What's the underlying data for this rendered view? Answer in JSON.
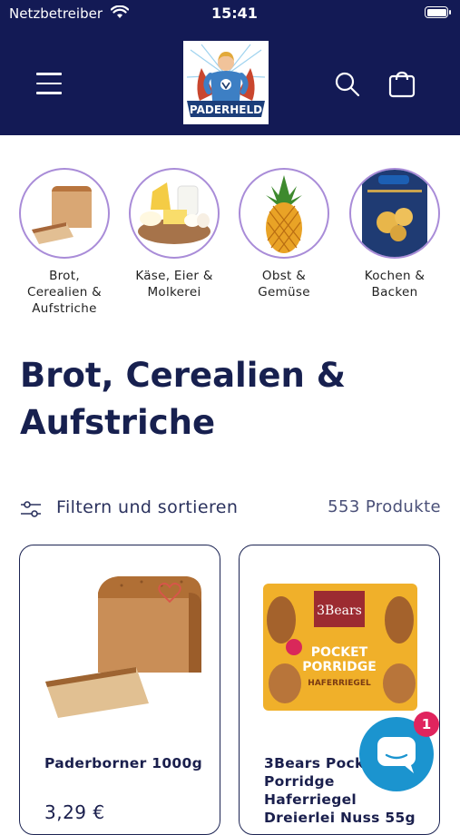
{
  "status_bar": {
    "carrier": "Netzbetreiber",
    "time": "15:41",
    "wifi_icon": "wifi-icon",
    "battery_icon": "battery-icon"
  },
  "header": {
    "menu_icon": "hamburger-menu-icon",
    "logo_text": "PADERHELD",
    "search_icon": "search-icon",
    "cart_icon": "shopping-bag-icon",
    "background": "#131a55"
  },
  "categories": [
    {
      "label": "Brot,\nCerealien &\nAufstriche"
    },
    {
      "label": "Käse, Eier &\nMolkerei"
    },
    {
      "label": "Obst &\nGemüse"
    },
    {
      "label": "Kochen &\nBacken"
    }
  ],
  "page_title": "Brot, Cerealien & Aufstriche",
  "filter": {
    "label": "Filtern und sortieren",
    "icon": "filter-sliders-icon",
    "product_count": "553 Produkte"
  },
  "products": [
    {
      "name": "Paderborner 1000g",
      "price": "3,29 €",
      "wishlist_icon": "heart-icon"
    },
    {
      "name": "3Bears Pocket Porridge Haferriegel Dreierlei Nuss 55g"
    }
  ],
  "chat": {
    "icon": "chat-bubble-icon",
    "badge_count": "1",
    "color": "#1b94cf"
  }
}
